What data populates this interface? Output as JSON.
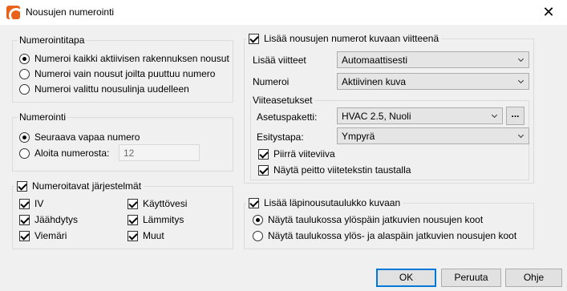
{
  "window": {
    "title": "Nousujen numerointi",
    "close_glyph": "✕"
  },
  "numbering_method": {
    "legend": "Numerointitapa",
    "options": [
      {
        "label": "Numeroi kaikki aktiivisen rakennuksen nousut",
        "checked": true
      },
      {
        "label": "Numeroi vain nousut joilta puuttuu numero",
        "checked": false
      },
      {
        "label": "Numeroi valittu nousulinja uudelleen",
        "checked": false
      }
    ]
  },
  "numbering": {
    "legend": "Numerointi",
    "next_free_label": "Seuraava vapaa numero",
    "start_from_label": "Aloita numerosta:",
    "start_from_value": "12",
    "next_free_checked": true
  },
  "systems": {
    "legend": "Numeroitavat järjestelmät",
    "legend_checked": true,
    "items": [
      {
        "label": "IV",
        "checked": true
      },
      {
        "label": "Käyttövesi",
        "checked": true
      },
      {
        "label": "Jäähdytys",
        "checked": true
      },
      {
        "label": "Lämmitys",
        "checked": true
      },
      {
        "label": "Viemäri",
        "checked": true
      },
      {
        "label": "Muut",
        "checked": true
      }
    ]
  },
  "add_to_refs": {
    "legend": "Lisää nousujen numerot kuvaan viitteenä",
    "legend_checked": true,
    "add_refs_label": "Lisää viitteet",
    "add_refs_value": "Automaattisesti",
    "numbering_label": "Numeroi",
    "numbering_value": "Aktiivinen kuva",
    "ref_settings_label": "Viiteasetukset",
    "settings_pkg_label": "Asetuspaketti:",
    "settings_pkg_value": "HVAC 2.5, Nuoli",
    "browse_label": "...",
    "display_label": "Esitystapa:",
    "display_value": "Ympyrä",
    "draw_leader_label": "Piirrä viiteviiva",
    "draw_leader_checked": true,
    "show_mask_label": "Näytä peitto viitetekstin taustalla",
    "show_mask_checked": true
  },
  "riser_table": {
    "legend": "Lisää läpinousutaulukko kuvaan",
    "legend_checked": true,
    "options": [
      {
        "label": "Näytä taulukossa ylöspäin jatkuvien nousujen koot",
        "checked": true
      },
      {
        "label": "Näytä taulukossa ylös- ja alaspäin jatkuvien nousujen koot",
        "checked": false
      }
    ]
  },
  "buttons": {
    "ok": "OK",
    "cancel": "Peruuta",
    "help": "Ohje"
  }
}
